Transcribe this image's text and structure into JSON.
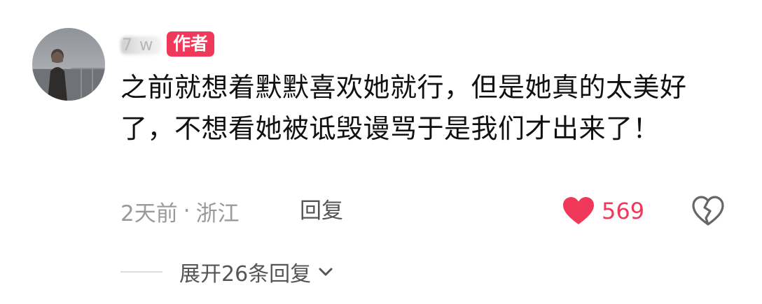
{
  "comment": {
    "username": "7 w",
    "author_badge": "作者",
    "text": "之前就想着默默喜欢她就行，但是她真的太美好了，不想看她被诋毁谩骂于是我们才出来了！",
    "time": "2天前",
    "separator": "·",
    "location": "浙江",
    "reply_label": "回复",
    "like_count": "569",
    "expand_label": "展开26条回复",
    "icons": {
      "like": "heart-icon",
      "dislike": "broken-heart-icon",
      "expand": "chevron-down-icon"
    },
    "colors": {
      "accent": "#f0385a",
      "text": "#111111",
      "meta": "#9a9a9a",
      "action": "#555555"
    }
  }
}
